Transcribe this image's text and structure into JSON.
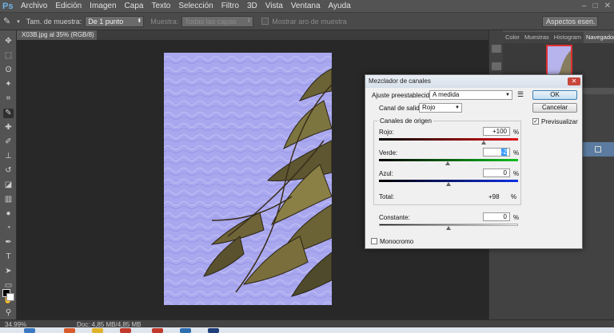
{
  "app": {
    "logo": "Ps"
  },
  "menu": [
    "Archivo",
    "Edición",
    "Imagen",
    "Capa",
    "Texto",
    "Selección",
    "Filtro",
    "3D",
    "Vista",
    "Ventana",
    "Ayuda"
  ],
  "window_controls": [
    "–",
    "□",
    "✕"
  ],
  "options_bar": {
    "sample_size_label": "Tam. de muestra:",
    "sample_size_value": "De 1 punto",
    "sample_label": "Muestra:",
    "sample_value": "Todas las capas",
    "show_ring_label": "Mostrar aro de muestra",
    "workspace_value": "Aspectos esen."
  },
  "document_tab": {
    "title": "X03B.jpg al 35% (RGB/8) *"
  },
  "panel_tabs": [
    "Color",
    "Muestras",
    "Histogram",
    "Navegador"
  ],
  "status": {
    "zoom": "34.99%",
    "doc_size": "Doc: 4,85 MB/4,85 MB"
  },
  "dialog": {
    "title": "Mezclador de canales",
    "preset_label": "Ajuste preestablecido:",
    "preset_value": "A medida",
    "output_channel_label": "Canal de salida:",
    "output_channel_value": "Rojo",
    "source_channels_label": "Canales de origen",
    "red_label": "Rojo:",
    "red_value": "+100",
    "green_label": "Verde:",
    "green_value": "-2",
    "blue_label": "Azul:",
    "blue_value": "0",
    "total_label": "Total:",
    "total_value": "+98",
    "constant_label": "Constante:",
    "constant_value": "0",
    "percent": "%",
    "monochrome_label": "Monocromo",
    "ok_label": "OK",
    "cancel_label": "Cancelar",
    "preview_label": "Previsualizar",
    "preview_checked": true,
    "sliders": {
      "red": 100,
      "green": -2,
      "blue": 0,
      "constant": 0
    }
  }
}
